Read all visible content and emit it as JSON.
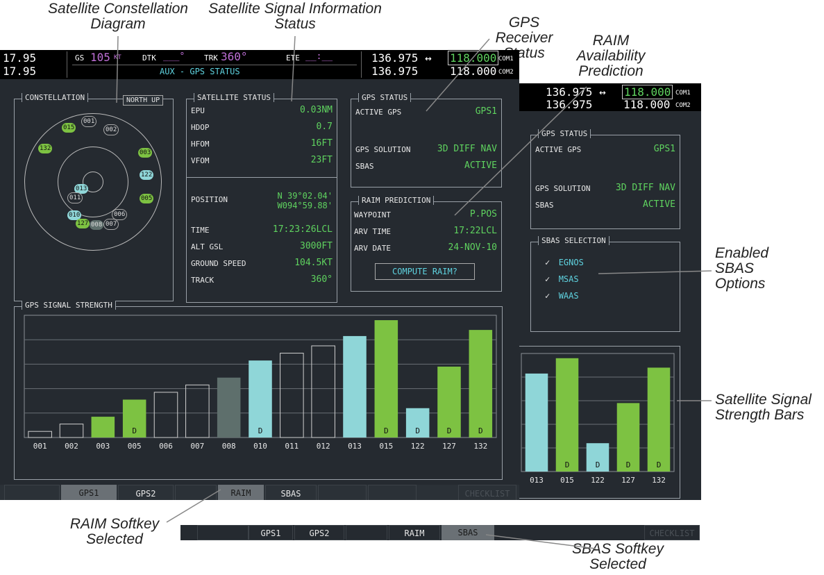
{
  "callouts": {
    "constellation_diagram": "Satellite Constellation Diagram",
    "signal_info": "Satellite Signal Information Status",
    "receiver_status": "GPS Receiver Status",
    "raim_prediction": "RAIM Availability Prediction",
    "enabled_sbas": "Enabled SBAS Options",
    "strength_bars": "Satellite Signal Strength Bars",
    "raim_softkey": "RAIM Softkey Selected",
    "sbas_softkey": "SBAS Softkey Selected"
  },
  "header": {
    "nav1": "17.95",
    "nav2": "17.95",
    "gs_label": "GS",
    "gs_value": "105",
    "gs_unit": "KT",
    "dtk_label": "DTK",
    "dtk_value": "___°",
    "trk_label": "TRK",
    "trk_value": "360°",
    "ete_label": "ETE",
    "ete_value": "__:__",
    "page_title": "AUX - GPS STATUS",
    "com1_standby": "136.975 ↔",
    "com1_active": "118.000",
    "com1_tag": "COM1",
    "com2_standby": "136.975",
    "com2_active": "118.000",
    "com2_tag": "COM2"
  },
  "constellation": {
    "title": "CONSTELLATION",
    "orientation": "NORTH UP",
    "satellites": [
      "001",
      "015",
      "002",
      "132",
      "003",
      "122",
      "013",
      "005",
      "011",
      "006",
      "010",
      "127",
      "008",
      "007"
    ]
  },
  "satellite_status": {
    "title": "SATELLITE STATUS",
    "rows": [
      {
        "label": "EPU",
        "value": "0.03NM"
      },
      {
        "label": "HDOP",
        "value": "0.7"
      },
      {
        "label": "HFOM",
        "value": "16FT"
      },
      {
        "label": "VFOM",
        "value": "23FT"
      }
    ],
    "position_label": "POSITION",
    "position_lat": "N 39°02.04'",
    "position_lon": "W094°59.88'",
    "rows2": [
      {
        "label": "TIME",
        "value": "17:23:26LCL"
      },
      {
        "label": "ALT GSL",
        "value": "3000FT"
      },
      {
        "label": "GROUND SPEED",
        "value": "104.5KT"
      },
      {
        "label": "TRACK",
        "value": "360°"
      }
    ]
  },
  "gps_status": {
    "title": "GPS STATUS",
    "active_gps_label": "ACTIVE GPS",
    "active_gps_value": "GPS1",
    "solution_label": "GPS SOLUTION",
    "solution_value": "3D DIFF NAV",
    "sbas_label": "SBAS",
    "sbas_value": "ACTIVE"
  },
  "raim": {
    "title": "RAIM PREDICTION",
    "waypoint_label": "WAYPOINT",
    "waypoint_value": "P.POS",
    "arv_time_label": "ARV TIME",
    "arv_time_value": "17:22LCL",
    "arv_date_label": "ARV DATE",
    "arv_date_value": "24-NOV-10",
    "compute_button": "COMPUTE RAIM?"
  },
  "sbas_selection": {
    "title": "SBAS SELECTION",
    "options": [
      "EGNOS",
      "MSAS",
      "WAAS"
    ]
  },
  "signal_strength": {
    "title": "GPS SIGNAL STRENGTH"
  },
  "softkeys_raim": [
    "GPS1",
    "GPS2",
    "RAIM",
    "SBAS",
    "CHECKLIST"
  ],
  "softkeys_sbas": [
    "GPS1",
    "GPS2",
    "RAIM",
    "SBAS",
    "CHECKLIST"
  ],
  "colors": {
    "background": "#252a30",
    "value_green": "#5fd35f",
    "bar_green": "#7dc242",
    "bar_cyan": "#8fd6d8",
    "bar_gray": "#5e6f6c"
  },
  "chart_data": {
    "type": "bar",
    "title": "GPS SIGNAL STRENGTH",
    "categories": [
      "001",
      "002",
      "003",
      "005",
      "006",
      "007",
      "008",
      "010",
      "011",
      "012",
      "013",
      "015",
      "122",
      "127",
      "132"
    ],
    "values": [
      0.05,
      0.11,
      0.17,
      0.31,
      0.37,
      0.43,
      0.49,
      0.63,
      0.69,
      0.75,
      0.83,
      0.96,
      0.24,
      0.58,
      0.88
    ],
    "status": [
      "empty",
      "empty",
      "green",
      "green",
      "empty",
      "empty",
      "gray",
      "cyan",
      "empty",
      "empty",
      "cyan",
      "green",
      "cyan",
      "green",
      "green"
    ],
    "differential": [
      "",
      "",
      "",
      "D",
      "",
      "",
      "",
      "D",
      "",
      "",
      "",
      "D",
      "D",
      "D",
      "D"
    ],
    "ylim": [
      0,
      1
    ]
  }
}
